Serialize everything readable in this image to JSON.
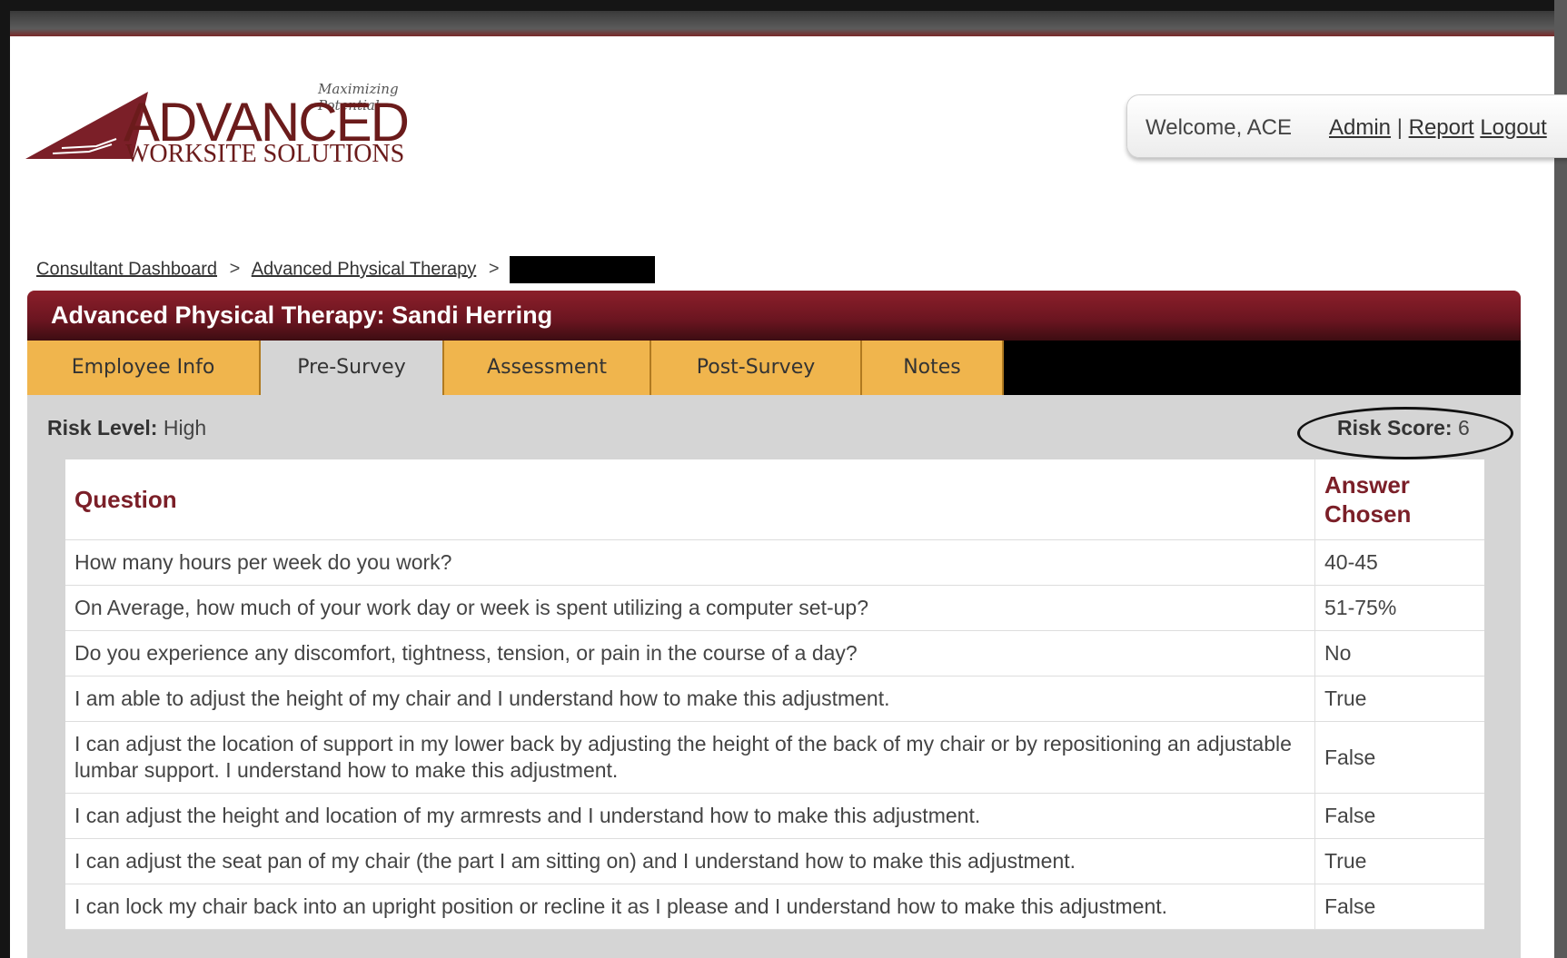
{
  "logo": {
    "tagline": "Maximizing Potential",
    "main": "ADVANCED",
    "sub": "WORKSITE SOLUTIONS"
  },
  "header": {
    "welcome": "Welcome, ACE",
    "links": {
      "admin": "Admin",
      "report": "Report",
      "logout": "Logout"
    }
  },
  "breadcrumb": {
    "items": [
      "Consultant Dashboard",
      "Advanced Physical Therapy"
    ],
    "separator": ">"
  },
  "panel": {
    "title": "Advanced Physical Therapy: Sandi Herring",
    "tabs": [
      "Employee Info",
      "Pre-Survey",
      "Assessment",
      "Post-Survey",
      "Notes"
    ],
    "active_tab": "Pre-Survey",
    "risk_level_label": "Risk Level:",
    "risk_level_value": "High",
    "risk_score_label": "Risk Score:",
    "risk_score_value": "6"
  },
  "table": {
    "headers": {
      "question": "Question",
      "answer": "Answer Chosen"
    },
    "rows": [
      {
        "q": "How many hours per week do you work?",
        "a": "40-45"
      },
      {
        "q": "On Average, how much of your work day or week is spent utilizing a computer set-up?",
        "a": "51-75%"
      },
      {
        "q": "Do you experience any discomfort, tightness, tension, or pain in the course of a day?",
        "a": "No"
      },
      {
        "q": "I am able to adjust the height of my chair and I understand how to make this adjustment.",
        "a": "True"
      },
      {
        "q": "I can adjust the location of support in my lower back by adjusting the height of the back of my chair or by repositioning an adjustable lumbar support. I understand how to make this adjustment.",
        "a": "False"
      },
      {
        "q": "I can adjust the height and location of my armrests and I understand how to make this adjustment.",
        "a": "False"
      },
      {
        "q": "I can adjust the seat pan of my chair (the part I am sitting on) and I understand how to make this adjustment.",
        "a": "True"
      },
      {
        "q": "I can lock my chair back into an upright position or recline it as I please and I understand how to make this adjustment.",
        "a": "False"
      }
    ]
  },
  "colors": {
    "brand": "#6b1b1b",
    "tab": "#f0b54d",
    "header_text": "#7b1f28"
  }
}
